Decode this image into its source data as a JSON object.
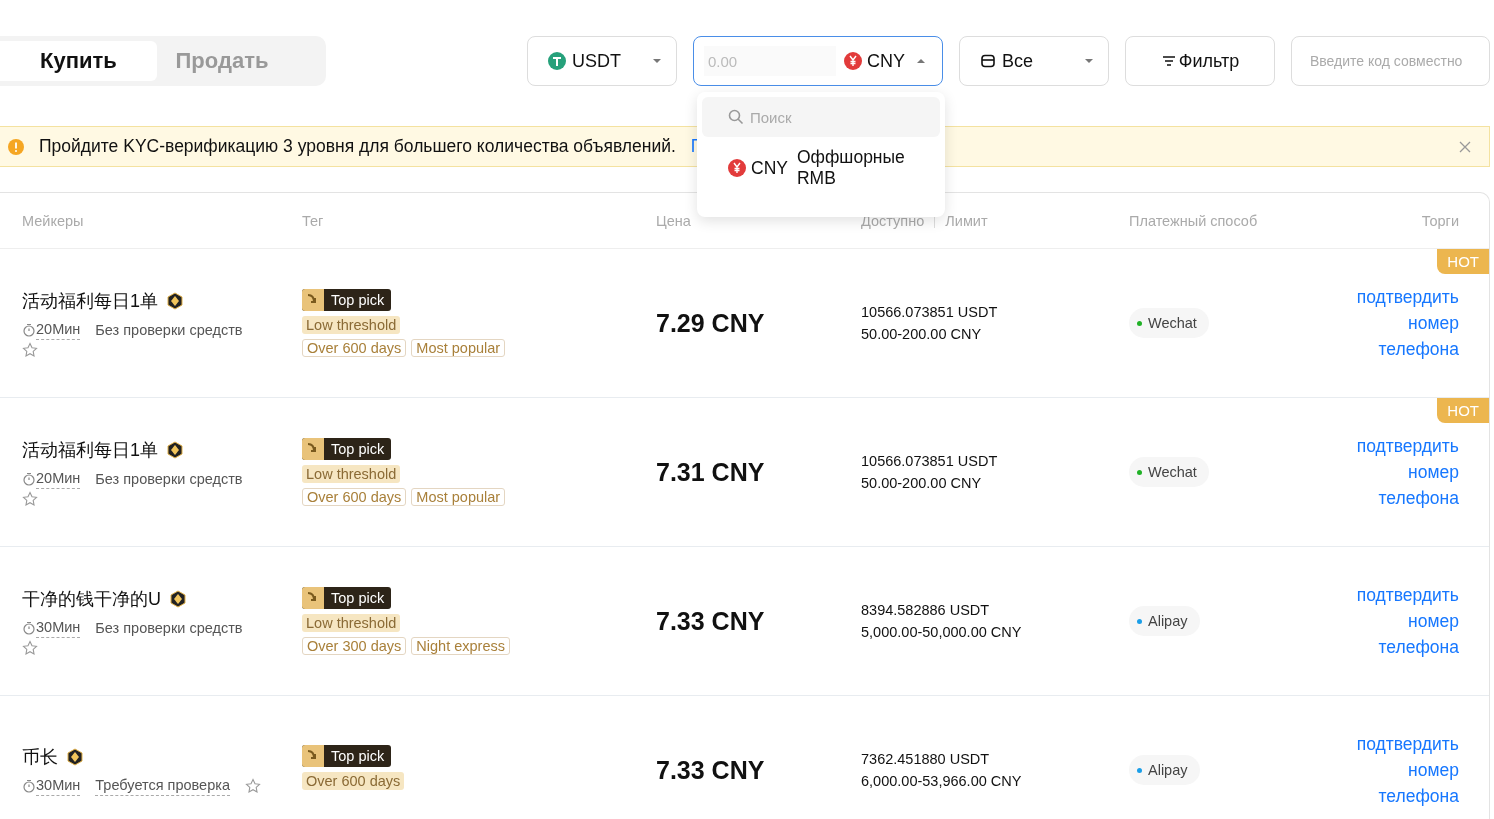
{
  "trade_tabs": [
    {
      "label": "Купить",
      "selected": true
    },
    {
      "label": "Продать",
      "selected": false
    }
  ],
  "filters": {
    "coin": "USDT",
    "amount_placeholder": "0.00",
    "fiat": "CNY",
    "fiat_expanded": true,
    "payment": "Все",
    "filter_button": "Фильтр",
    "code_placeholder": "Введите код совместно"
  },
  "fiat_dropdown": {
    "search_placeholder": "Поиск",
    "options": [
      {
        "code": "CNY",
        "name": "Оффшорные RMB"
      }
    ]
  },
  "banner": {
    "text": "Пройдите KYC-верификацию 3 уровня для большего количества объявлений.",
    "link": "Г"
  },
  "table": {
    "columns": {
      "makers": "Мейкеры",
      "tag": "Тег",
      "price": "Цена",
      "available": "Доступно",
      "limit": "Лимит",
      "payment": "Платежный способ",
      "trade": "Торги"
    },
    "rows": [
      {
        "name": "活动福利每日1单",
        "time": "20Мин",
        "verification": "Без проверки средств",
        "verification_required": false,
        "tags": [
          {
            "kind": "top",
            "label": "Top pick"
          },
          {
            "kind": "filled",
            "label": "Low threshold"
          },
          {
            "kind": "outline",
            "label": "Over 600 days"
          },
          {
            "kind": "outline",
            "label": "Most popular"
          }
        ],
        "price": "7.29 CNY",
        "available": "10566.073851 USDT",
        "limit": "50.00-200.00 CNY",
        "payment": "Wechat",
        "color": "#20b126",
        "action": "подтвердить номер телефона",
        "hot": "HOT"
      },
      {
        "name": "活动福利每日1单",
        "time": "20Мин",
        "verification": "Без проверки средств",
        "verification_required": false,
        "tags": [
          {
            "kind": "top",
            "label": "Top pick"
          },
          {
            "kind": "filled",
            "label": "Low threshold"
          },
          {
            "kind": "outline",
            "label": "Over 600 days"
          },
          {
            "kind": "outline",
            "label": "Most popular"
          }
        ],
        "price": "7.31 CNY",
        "available": "10566.073851 USDT",
        "limit": "50.00-200.00 CNY",
        "payment": "Wechat",
        "color": "#20b126",
        "action": "подтвердить номер телефона",
        "hot": "HOT"
      },
      {
        "name": "干净的钱干净的U",
        "time": "30Мин",
        "verification": "Без проверки средств",
        "verification_required": false,
        "tags": [
          {
            "kind": "top",
            "label": "Top pick"
          },
          {
            "kind": "filled",
            "label": "Low threshold"
          },
          {
            "kind": "outline",
            "label": "Over 300 days"
          },
          {
            "kind": "outline",
            "label": "Night express"
          }
        ],
        "price": "7.33 CNY",
        "available": "8394.582886 USDT",
        "limit": "5,000.00-50,000.00 CNY",
        "payment": "Alipay",
        "color": "#1a9ee8",
        "action": "подтвердить номер телефона"
      },
      {
        "name": "币长",
        "time": "30Мин",
        "verification": "Требуется проверка",
        "verification_required": true,
        "tags": [
          {
            "kind": "top",
            "label": "Top pick"
          },
          {
            "kind": "filled",
            "label": "Over 600 days"
          }
        ],
        "price": "7.33 CNY",
        "available": "7362.451880 USDT",
        "limit": "6,000.00-53,966.00 CNY",
        "payment": "Alipay",
        "color": "#1a9ee8",
        "action": "подтвердить номер телефона"
      }
    ]
  }
}
